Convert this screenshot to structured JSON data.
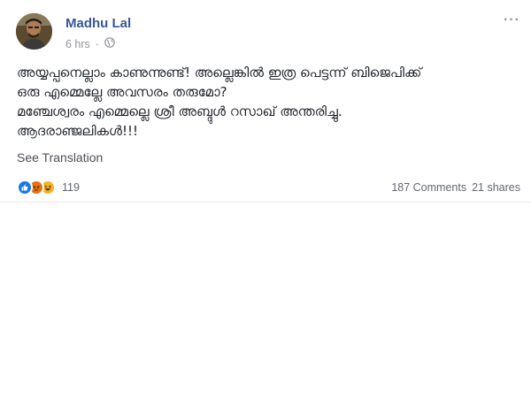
{
  "post": {
    "author": "Madhu Lal",
    "timestamp": "6 hrs",
    "separator": "·",
    "audience_icon": "globe-icon",
    "options_label": "···",
    "lines": [
      "അയ്യപ്പനെല്ലാം കാണുന്നുണ്ട്! അല്ലെങ്കിൽ ഇത്ര പെട്ടന്ന് ബിജെപിക്ക്",
      "ഒരു എമ്മെല്ലേ അവസരം തരുമോ?",
      "മഞ്ചേശ്വരം എമ്മെല്ലെ ശ്രീ അബ്ദുൾ റസാഖ് അന്തരിച്ചു.",
      "ആദരാഞ്ജലികൾ!!!"
    ],
    "see_translation": "See Translation"
  },
  "footer": {
    "reactions": [
      "like",
      "angry",
      "haha"
    ],
    "reaction_count": "119",
    "comments": "187 Comments",
    "shares": "21 shares"
  },
  "colors": {
    "link": "#365899",
    "meta": "#90949c",
    "like": "#1877f2",
    "angry": "#e9710f",
    "haha": "#f7b125"
  }
}
